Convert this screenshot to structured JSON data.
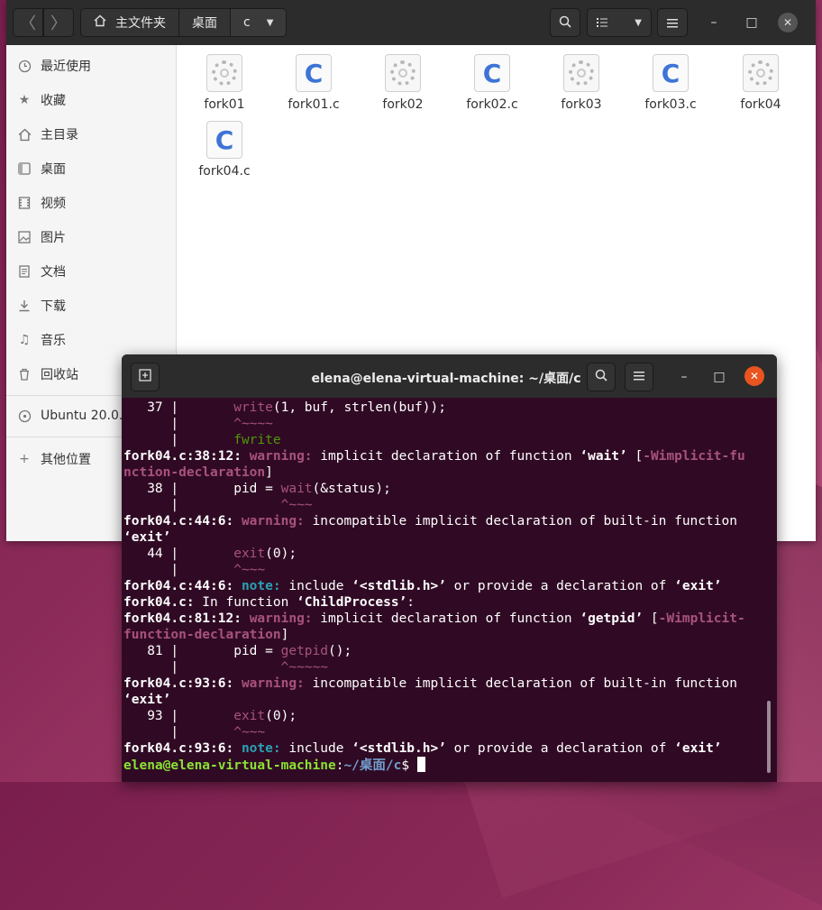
{
  "files_window": {
    "path": [
      "主文件夹",
      "桌面",
      "c"
    ],
    "sidebar": [
      {
        "label": "最近使用",
        "icon": "clock-icon"
      },
      {
        "label": "收藏",
        "icon": "star-icon"
      },
      {
        "label": "主目录",
        "icon": "home-icon"
      },
      {
        "label": "桌面",
        "icon": "desktop-icon"
      },
      {
        "label": "视频",
        "icon": "video-icon"
      },
      {
        "label": "图片",
        "icon": "picture-icon"
      },
      {
        "label": "文档",
        "icon": "document-icon"
      },
      {
        "label": "下载",
        "icon": "download-icon"
      },
      {
        "label": "音乐",
        "icon": "music-icon"
      },
      {
        "label": "回收站",
        "icon": "trash-icon"
      },
      {
        "label": "Ubuntu 20.0...",
        "icon": "disc-icon"
      },
      {
        "label": "其他位置",
        "icon": "plus-icon"
      }
    ],
    "files": [
      {
        "name": "fork01",
        "type": "executable"
      },
      {
        "name": "fork01.c",
        "type": "c-source"
      },
      {
        "name": "fork02",
        "type": "executable"
      },
      {
        "name": "fork02.c",
        "type": "c-source"
      },
      {
        "name": "fork03",
        "type": "executable"
      },
      {
        "name": "fork03.c",
        "type": "c-source"
      },
      {
        "name": "fork04",
        "type": "executable"
      },
      {
        "name": "fork04.c",
        "type": "c-source"
      }
    ]
  },
  "terminal": {
    "title": "elena@elena-virtual-machine: ~/桌面/c",
    "lines": [
      {
        "segs": [
          [
            "   37 |       ",
            ""
          ],
          [
            "write",
            "hl"
          ],
          [
            "(1, buf, strlen(buf));",
            ""
          ]
        ]
      },
      {
        "segs": [
          [
            "      |       ",
            ""
          ],
          [
            "^~~~~",
            "dim"
          ]
        ]
      },
      {
        "segs": [
          [
            "      |       ",
            ""
          ],
          [
            "fwrite",
            "grn"
          ]
        ]
      },
      {
        "segs": [
          [
            "fork04.c:38:12: ",
            "b"
          ],
          [
            "warning: ",
            "warn"
          ],
          [
            "implicit declaration of function ",
            ""
          ],
          [
            "‘wait’",
            "b"
          ],
          [
            " [",
            ""
          ],
          [
            "-Wimplicit-fu",
            "warn"
          ]
        ]
      },
      {
        "segs": [
          [
            "nction-declaration",
            "warn"
          ],
          [
            "]",
            ""
          ]
        ]
      },
      {
        "segs": [
          [
            "   38 |       pid = ",
            ""
          ],
          [
            "wait",
            "hl"
          ],
          [
            "(&status);",
            ""
          ]
        ]
      },
      {
        "segs": [
          [
            "      |             ",
            ""
          ],
          [
            "^~~~",
            "dim"
          ]
        ]
      },
      {
        "segs": [
          [
            "fork04.c:44:6: ",
            "b"
          ],
          [
            "warning: ",
            "warn"
          ],
          [
            "incompatible implicit declaration of built-in function",
            ""
          ]
        ]
      },
      {
        "segs": [
          [
            "‘exit’",
            "b"
          ]
        ]
      },
      {
        "segs": [
          [
            "   44 |       ",
            ""
          ],
          [
            "exit",
            "hl"
          ],
          [
            "(0);",
            ""
          ]
        ]
      },
      {
        "segs": [
          [
            "      |       ",
            ""
          ],
          [
            "^~~~",
            "dim"
          ]
        ]
      },
      {
        "segs": [
          [
            "fork04.c:44:6: ",
            "b"
          ],
          [
            "note: ",
            "note"
          ],
          [
            "include ",
            ""
          ],
          [
            "‘<stdlib.h>’",
            "b"
          ],
          [
            " or provide a declaration of ",
            ""
          ],
          [
            "‘exit’",
            "b"
          ]
        ]
      },
      {
        "segs": [
          [
            "fork04.c:",
            "b"
          ],
          [
            " In function ",
            ""
          ],
          [
            "‘ChildProcess’",
            "b"
          ],
          [
            ":",
            ""
          ]
        ]
      },
      {
        "segs": [
          [
            "fork04.c:81:12: ",
            "b"
          ],
          [
            "warning: ",
            "warn"
          ],
          [
            "implicit declaration of function ",
            ""
          ],
          [
            "‘getpid’",
            "b"
          ],
          [
            " [",
            ""
          ],
          [
            "-Wimplicit-",
            "warn"
          ]
        ]
      },
      {
        "segs": [
          [
            "function-declaration",
            "warn"
          ],
          [
            "]",
            ""
          ]
        ]
      },
      {
        "segs": [
          [
            "   81 |       pid = ",
            ""
          ],
          [
            "getpid",
            "hl"
          ],
          [
            "();",
            ""
          ]
        ]
      },
      {
        "segs": [
          [
            "      |             ",
            ""
          ],
          [
            "^~~~~~",
            "dim"
          ]
        ]
      },
      {
        "segs": [
          [
            "fork04.c:93:6: ",
            "b"
          ],
          [
            "warning: ",
            "warn"
          ],
          [
            "incompatible implicit declaration of built-in function",
            ""
          ]
        ]
      },
      {
        "segs": [
          [
            "‘exit’",
            "b"
          ]
        ]
      },
      {
        "segs": [
          [
            "   93 |       ",
            ""
          ],
          [
            "exit",
            "hl"
          ],
          [
            "(0);",
            ""
          ]
        ]
      },
      {
        "segs": [
          [
            "      |       ",
            ""
          ],
          [
            "^~~~",
            "dim"
          ]
        ]
      },
      {
        "segs": [
          [
            "fork04.c:93:6: ",
            "b"
          ],
          [
            "note: ",
            "note"
          ],
          [
            "include ",
            ""
          ],
          [
            "‘<stdlib.h>’",
            "b"
          ],
          [
            " or provide a declaration of ",
            ""
          ],
          [
            "‘exit’",
            "b"
          ]
        ]
      }
    ],
    "prompt": {
      "user": "elena@elena-virtual-machine",
      "sep": ":",
      "path": "~/桌面/c",
      "sym": "$ "
    }
  },
  "colors": {
    "terminal_bg": "#300a24",
    "accent_close": "#e95420",
    "c_icon": "#3d74d6"
  }
}
